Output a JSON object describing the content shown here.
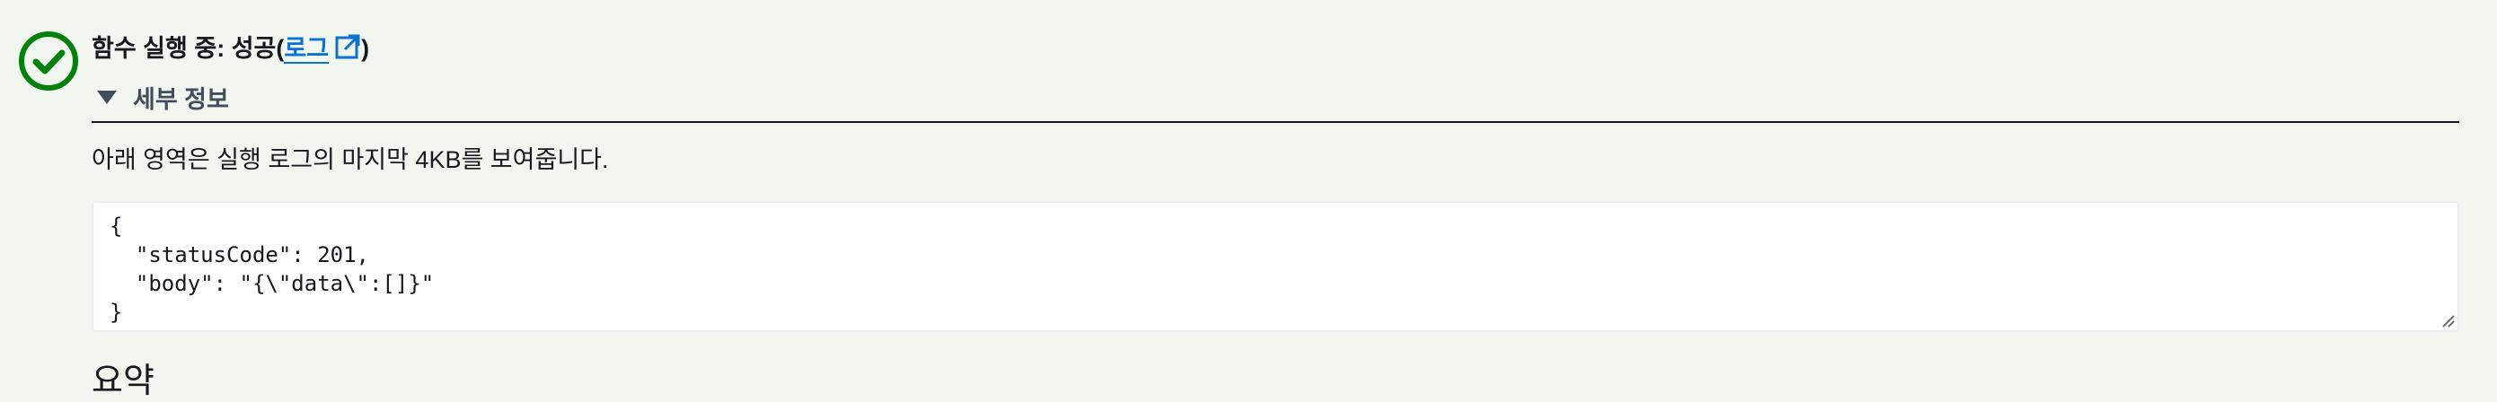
{
  "status": {
    "icon": "check-circle-icon",
    "color": "#037f0c",
    "title_prefix": "함수 실행 중: 성공(",
    "log_link_label": "로그",
    "external_icon": "external-link-icon",
    "title_suffix": ")"
  },
  "details": {
    "toggle_label": "세부 정보",
    "expanded": true,
    "description": "아래 영역은 실행 로그의 마지막 4KB를 보여줍니다.",
    "output": "{\n  \"statusCode\": 201,\n  \"body\": \"{\\\"data\\\":[]}\"\n}"
  },
  "summary": {
    "heading": "요약"
  },
  "colors": {
    "background": "#f1f7ef",
    "success": "#037f0c",
    "link": "#0972d3",
    "text": "#16191f"
  }
}
